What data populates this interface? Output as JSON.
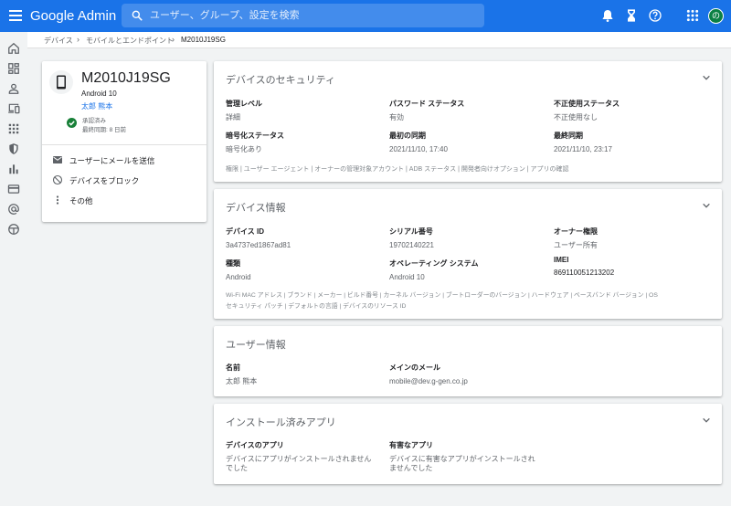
{
  "header": {
    "brand": "Google Admin",
    "search_placeholder": "ユーザー、グループ、設定を検索",
    "avatar_initial": "の"
  },
  "icons": {
    "menu": "hamburger-menu-icon",
    "search": "search-icon",
    "top_actions": [
      "bell-icon",
      "hourglass-icon",
      "help-icon",
      "apps-grid-icon"
    ],
    "rail": [
      "home-icon",
      "dashboard-icon",
      "person-icon",
      "devices-icon",
      "apps-icon",
      "security-shield-icon",
      "reports-bar-chart-icon",
      "billing-card-icon",
      "account-at-icon",
      "rules-icon"
    ]
  },
  "breadcrumb": {
    "items": [
      "デバイス",
      "モバイルとエンドポイント",
      "M2010J19SG"
    ]
  },
  "device": {
    "name": "M2010J19SG",
    "os": "Android 10",
    "user": "太郎 熊本",
    "status": "承認済み",
    "last_sync": "最終同期: 8 日前",
    "actions": [
      {
        "label": "ユーザーにメールを送信",
        "icon": "mail-icon"
      },
      {
        "label": "デバイスをブロック",
        "icon": "block-icon"
      },
      {
        "label": "その他",
        "icon": "more-vert-icon"
      }
    ]
  },
  "security": {
    "title": "デバイスのセキュリティ",
    "fields": [
      {
        "label": "管理レベル",
        "value": "詳細"
      },
      {
        "label": "パスワード ステータス",
        "value": "有効"
      },
      {
        "label": "不正使用ステータス",
        "value": "不正使用なし"
      },
      {
        "label": "暗号化ステータス",
        "value": "暗号化あり"
      },
      {
        "label": "最初の同期",
        "value": "2021/11/10, 17:40"
      },
      {
        "label": "最終同期",
        "value": "2021/11/10, 23:17"
      }
    ],
    "links": "権限 | ユーザー エージェント | オーナーの管理対象アカウント | ADB ステータス | 開発者向けオプション | アプリの確認"
  },
  "device_info": {
    "title": "デバイス情報",
    "fields": [
      {
        "label": "デバイス ID",
        "value": "3a4737ed1867ad81"
      },
      {
        "label": "シリアル番号",
        "value": "19702140221"
      },
      {
        "label": "オーナー権限",
        "value": "ユーザー所有"
      },
      {
        "label": "種類",
        "value": "Android"
      },
      {
        "label": "オペレーティング システム",
        "value": "Android 10"
      },
      {
        "label": "IMEI",
        "value": "869110051213202"
      }
    ],
    "links_line1": "Wi-Fi MAC アドレス | ブランド | メーカー | ビルド番号 | カーネル バージョン | ブートローダーのバージョン | ハードウェア | ベースバンド バージョン | OS",
    "links_line2": "セキュリティ パッチ | デフォルトの言語 | デバイスのリソース ID"
  },
  "user_info": {
    "title": "ユーザー情報",
    "fields": [
      {
        "label": "名前",
        "value": "太郎 熊本"
      },
      {
        "label": "メインのメール",
        "value": "mobile@dev.g-gen.co.jp"
      }
    ]
  },
  "installed_apps": {
    "title": "インストール済みアプリ",
    "fields": [
      {
        "label": "デバイスのアプリ",
        "value_line1": "デバイスにアプリがインストールされません",
        "value_line2": "でした"
      },
      {
        "label": "有害なアプリ",
        "value_line1": "デバイスに有害なアプリがインストールされ",
        "value_line2": "ませんでした"
      }
    ]
  },
  "colors": {
    "brand_blue": "#1a73e8",
    "success_green": "#188038",
    "background": "#f1f3f4"
  }
}
